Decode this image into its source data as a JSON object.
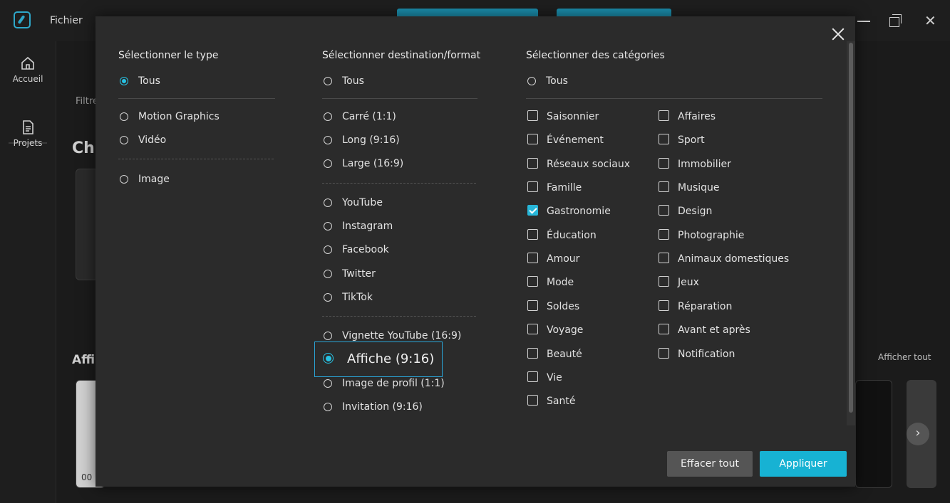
{
  "app": {
    "menu_file": "Fichier"
  },
  "sidebar": {
    "items": [
      {
        "label": "Accueil",
        "icon": "home-icon"
      },
      {
        "label": "Projets",
        "icon": "document-icon"
      }
    ]
  },
  "background": {
    "filter_partial": "Filtre",
    "heading_partial": "Ch",
    "section_partial": "Affi",
    "show_all": "Afficher tout",
    "timestamp_partial": "00"
  },
  "modal": {
    "type": {
      "title": "Sélectionner le type",
      "options": [
        "Tous",
        "Motion Graphics",
        "Vidéo",
        "Image"
      ],
      "selected": 0
    },
    "destination": {
      "title": "Sélectionner destination/format",
      "options": [
        "Tous",
        "Carré (1:1)",
        "Long (9:16)",
        "Large (16:9)",
        "YouTube",
        "Instagram",
        "Facebook",
        "Twitter",
        "TikTok",
        "Vignette YouTube (16:9)",
        "Affiche (9:16)",
        "Image de profil (1:1)",
        "Invitation (9:16)"
      ],
      "selected": 10
    },
    "categories": {
      "title": "Sélectionner des catégories",
      "all_label": "Tous",
      "left": [
        {
          "label": "Saisonnier",
          "checked": false
        },
        {
          "label": "Événement",
          "checked": false
        },
        {
          "label": "Réseaux sociaux",
          "checked": false
        },
        {
          "label": "Famille",
          "checked": false
        },
        {
          "label": "Gastronomie",
          "checked": true
        },
        {
          "label": "Éducation",
          "checked": false
        },
        {
          "label": "Amour",
          "checked": false
        },
        {
          "label": "Mode",
          "checked": false
        },
        {
          "label": "Soldes",
          "checked": false
        },
        {
          "label": "Voyage",
          "checked": false
        },
        {
          "label": "Beauté",
          "checked": false
        },
        {
          "label": "Vie",
          "checked": false
        },
        {
          "label": "Santé",
          "checked": false
        }
      ],
      "right": [
        {
          "label": "Affaires",
          "checked": false
        },
        {
          "label": "Sport",
          "checked": false
        },
        {
          "label": "Immobilier",
          "checked": false
        },
        {
          "label": "Musique",
          "checked": false
        },
        {
          "label": "Design",
          "checked": false
        },
        {
          "label": "Photographie",
          "checked": false
        },
        {
          "label": "Animaux domestiques",
          "checked": false
        },
        {
          "label": "Jeux",
          "checked": false
        },
        {
          "label": "Réparation",
          "checked": false
        },
        {
          "label": "Avant et après",
          "checked": false
        },
        {
          "label": "Notification",
          "checked": false
        }
      ]
    },
    "buttons": {
      "clear": "Effacer tout",
      "apply": "Appliquer"
    }
  },
  "colors": {
    "accent": "#17b2d3",
    "modal_bg": "#2b2b2b",
    "app_bg": "#1b1b1b"
  }
}
